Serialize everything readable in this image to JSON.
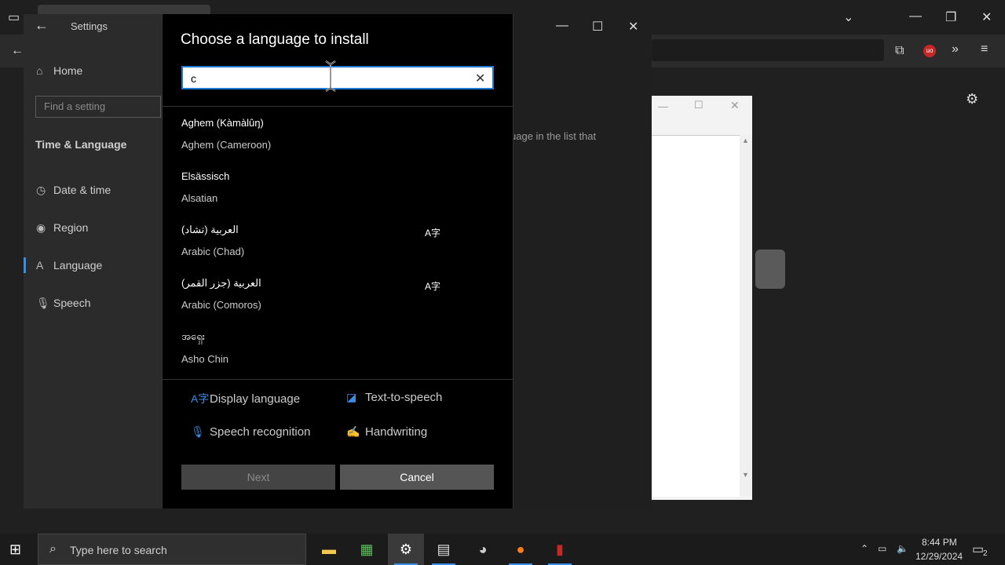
{
  "browser": {
    "toolbar_icons": [
      "extensions-icon",
      "ublock-icon",
      "overflow-icon",
      "menu-icon"
    ]
  },
  "settings": {
    "title": "Settings",
    "nav": {
      "home": "Home",
      "find_placeholder": "Find a setting",
      "section": "Time & Language",
      "items": [
        {
          "label": "Date & time",
          "icon": "clock-icon"
        },
        {
          "label": "Region",
          "icon": "globe-icon"
        },
        {
          "label": "Language",
          "icon": "language-icon"
        },
        {
          "label": "Speech",
          "icon": "microphone-icon"
        }
      ]
    },
    "background_text": "uage in the list that"
  },
  "dialog": {
    "title": "Choose a language to install",
    "search_value": "c",
    "languages": [
      {
        "native": "Aghem (Kàmàlûŋ)",
        "english": "Aghem (Cameroon)",
        "display_lang": false
      },
      {
        "native": "Elsässisch",
        "english": "Alsatian",
        "display_lang": false
      },
      {
        "native": "العربية (تشاد)",
        "english": "Arabic (Chad)",
        "display_lang": true
      },
      {
        "native": "العربية (جزر القمر)",
        "english": "Arabic (Comoros)",
        "display_lang": true
      },
      {
        "native": "အရှေး",
        "english": "Asho Chin",
        "display_lang": false
      }
    ],
    "legend": {
      "display_language": "Display language",
      "text_to_speech": "Text-to-speech",
      "speech_recognition": "Speech recognition",
      "handwriting": "Handwriting"
    },
    "next_label": "Next",
    "cancel_label": "Cancel"
  },
  "taskbar": {
    "search_placeholder": "Type here to search",
    "time": "8:44 PM",
    "date": "12/29/2024",
    "notification_count": "2",
    "accent_color": "#3a8ee6"
  }
}
